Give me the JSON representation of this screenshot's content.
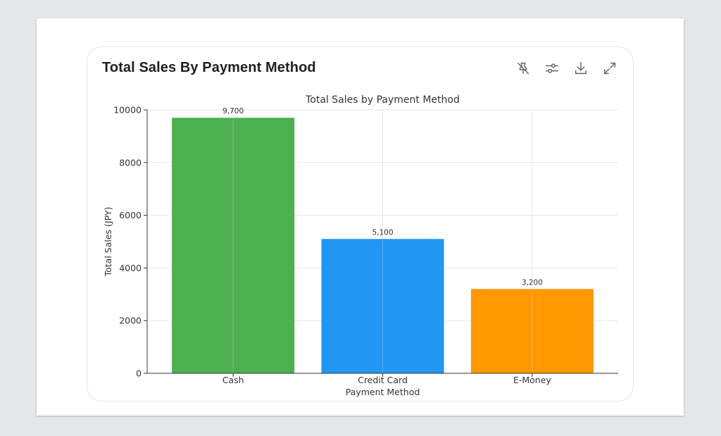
{
  "card": {
    "title": "Total Sales By Payment Method",
    "tools": [
      {
        "icon": "pin-off-icon",
        "label": "Unpin"
      },
      {
        "icon": "sliders-icon",
        "label": "Adjust"
      },
      {
        "icon": "download-icon",
        "label": "Download"
      },
      {
        "icon": "expand-icon",
        "label": "Expand"
      }
    ]
  },
  "chart_data": {
    "type": "bar",
    "title": "Total Sales by Payment Method",
    "xlabel": "Payment Method",
    "ylabel": "Total Sales (JPY)",
    "categories": [
      "Cash",
      "Credit Card",
      "E-Money"
    ],
    "values": [
      9700,
      5100,
      3200
    ],
    "value_labels": [
      "9,700",
      "5,100",
      "3,200"
    ],
    "colors": [
      "#4caf50",
      "#2196f3",
      "#ff9800"
    ],
    "ylim": [
      0,
      10000
    ],
    "yticks": [
      0,
      2000,
      4000,
      6000,
      8000,
      10000
    ],
    "grid": true,
    "legend": "none"
  }
}
